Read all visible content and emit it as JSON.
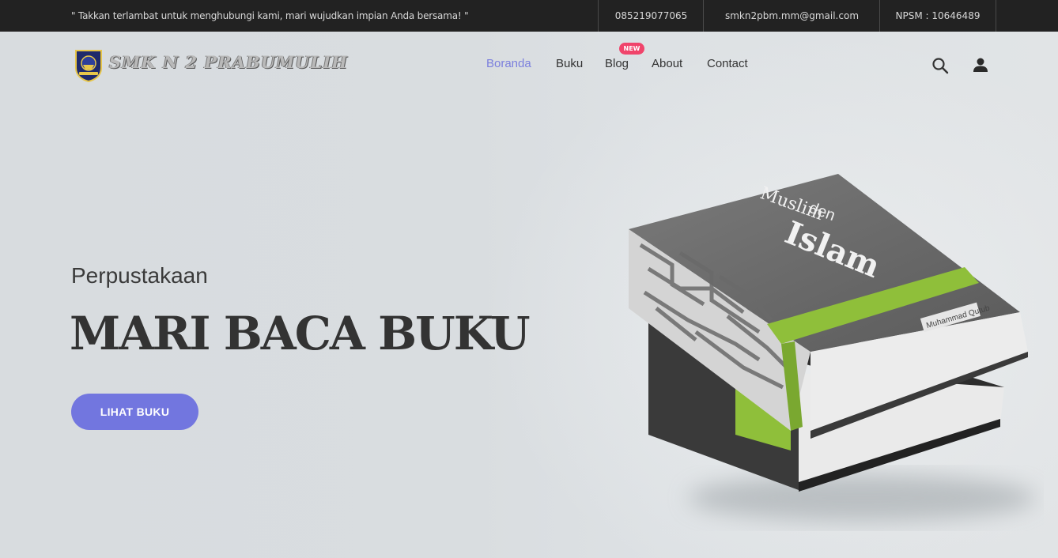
{
  "topbar": {
    "tagline": "\" Takkan terlambat untuk menghubungi kami, mari wujudkan impian Anda bersama! \"",
    "phone": "085219077065",
    "email": "smkn2pbm.mm@gmail.com",
    "npsm": "NPSM : 10646489"
  },
  "header": {
    "brand": "SMK N 2 PRABUMULIH",
    "nav": [
      {
        "label": "Boranda",
        "active": true
      },
      {
        "label": "Buku"
      },
      {
        "label": "Blog",
        "badge": "NEW"
      },
      {
        "label": "About"
      },
      {
        "label": "Contact"
      }
    ],
    "icons": [
      "search-icon",
      "user-icon"
    ],
    "accent": "#7b7fdd",
    "badge_color": "#f0446b"
  },
  "hero": {
    "subtitle": "Perpustakaan",
    "headline": "MARI BACA BUKU",
    "cta": "LIHAT BUKU",
    "cta_color": "#7276df",
    "book": {
      "title_line1": "Muslim",
      "title_line2": "den",
      "title_line3": "Islam",
      "author": "Muhammad Qutub"
    }
  }
}
